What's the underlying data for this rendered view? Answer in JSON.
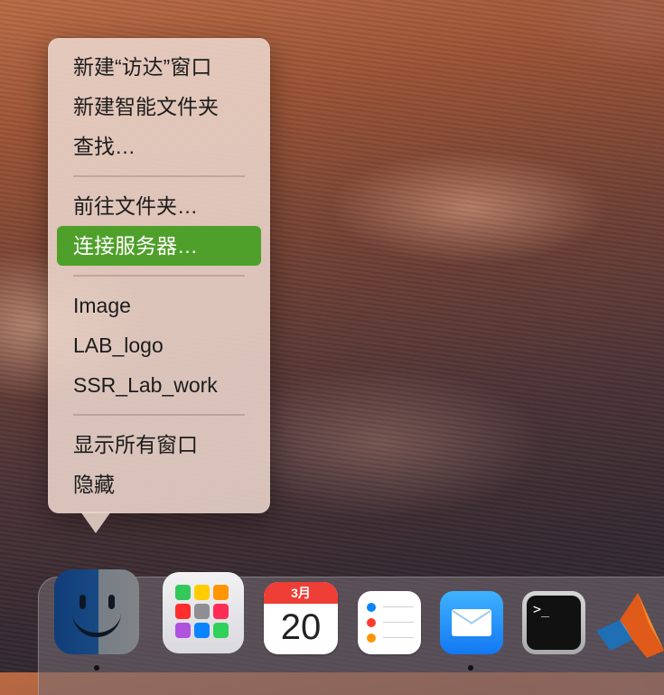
{
  "context_menu": {
    "items": [
      {
        "label": "新建“访达”窗口",
        "highlighted": false
      },
      {
        "label": "新建智能文件夹",
        "highlighted": false
      },
      {
        "label": "查找…",
        "highlighted": false
      },
      {
        "label": "前往文件夹…",
        "highlighted": false
      },
      {
        "label": "连接服务器…",
        "highlighted": true
      },
      {
        "label": "Image",
        "highlighted": false
      },
      {
        "label": "LAB_logo",
        "highlighted": false
      },
      {
        "label": "SSR_Lab_work",
        "highlighted": false
      },
      {
        "label": "显示所有窗口",
        "highlighted": false
      },
      {
        "label": "隐藏",
        "highlighted": false
      }
    ],
    "highlight_color": "#4fa02a"
  },
  "dock": {
    "apps": [
      {
        "icon": "finder-icon",
        "running": true
      },
      {
        "icon": "launchpad-icon",
        "running": false
      },
      {
        "icon": "calendar-icon",
        "month": "3月",
        "day": "20",
        "running": false
      },
      {
        "icon": "reminders-icon",
        "running": false
      },
      {
        "icon": "mail-icon",
        "running": true
      },
      {
        "icon": "terminal-icon",
        "prompt": ">_",
        "running": false
      },
      {
        "icon": "matlab-icon",
        "running": false
      }
    ]
  }
}
